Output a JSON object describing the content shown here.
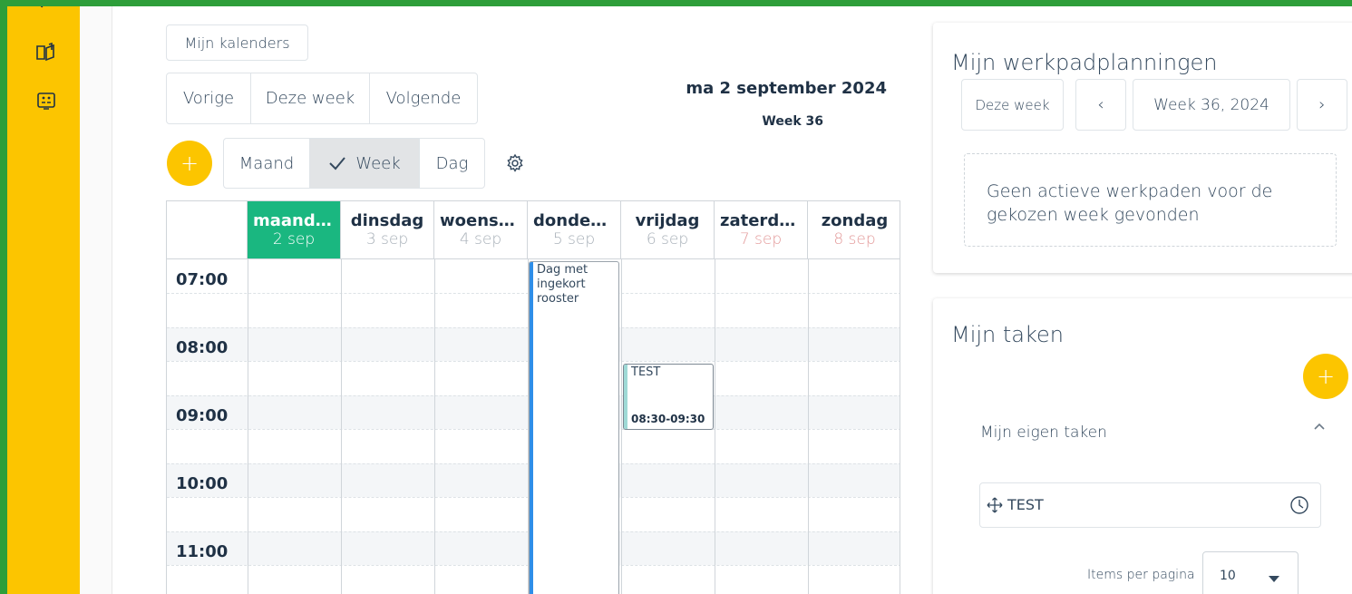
{
  "calendar_toolbar": {
    "my_calendars": "Mijn kalenders",
    "nav": {
      "previous": "Vorige",
      "this_week": "Deze week",
      "next": "Volgende"
    },
    "date_title": "ma 2 september 2024",
    "week_label": "Week 36",
    "views": {
      "month": "Maand",
      "week": "Week",
      "day": "Dag",
      "active": "week"
    },
    "add_symbol": "+"
  },
  "calendar": {
    "days": [
      {
        "name": "maandag",
        "date": "2 sep",
        "state": "today"
      },
      {
        "name": "dinsdag",
        "date": "3 sep",
        "state": "normal"
      },
      {
        "name": "woensdag",
        "date": "4 sep",
        "state": "normal"
      },
      {
        "name": "donderdag",
        "date": "5 sep",
        "state": "normal"
      },
      {
        "name": "vrijdag",
        "date": "6 sep",
        "state": "normal"
      },
      {
        "name": "zaterdag",
        "date": "7 sep",
        "state": "weekend"
      },
      {
        "name": "zondag",
        "date": "8 sep",
        "state": "weekend"
      }
    ],
    "hours": [
      "07:00",
      "08:00",
      "09:00",
      "10:00",
      "11:00"
    ],
    "events": [
      {
        "title": "Dag met ingekort rooster",
        "time": "",
        "day_index": 3,
        "color": "#2f8ee8"
      },
      {
        "title": "TEST",
        "time": "08:30-09:30",
        "day_index": 4,
        "color": "#9fd9d6"
      }
    ],
    "today_color": "#1ab780"
  },
  "workpath": {
    "title": "Mijn werkpadplanningen",
    "this_week": "Deze week",
    "prev_symbol": "‹",
    "week_value": "Week 36, 2024",
    "next_symbol": "›",
    "empty_message": "Geen actieve werkpaden voor de gekozen week gevonden"
  },
  "tasks": {
    "title": "Mijn taken",
    "add_symbol": "+",
    "section_title": "Mijn eigen taken",
    "items": [
      {
        "label": "TEST"
      }
    ],
    "items_per_page_label": "Items per pagina",
    "items_per_page_value": "10"
  },
  "colors": {
    "accent": "#fcc500",
    "frame": "#2e9e3a",
    "text": "#34495e"
  }
}
